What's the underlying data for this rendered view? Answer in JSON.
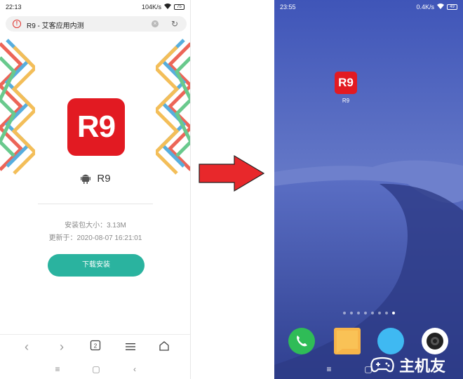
{
  "left_phone": {
    "status": {
      "time": "22:13",
      "speed": "104K/s",
      "battery": "75"
    },
    "url_bar": {
      "title": "R9 - 艾客应用内测"
    },
    "app": {
      "icon_text": "R9",
      "name": "R9"
    },
    "info": {
      "size": "安装包大小：3.13M",
      "updated": "更新于：2020-08-07 16:21:01"
    },
    "download_label": "下载安装"
  },
  "right_phone": {
    "status": {
      "time": "23:55",
      "speed": "0.4K/s",
      "battery": "49"
    },
    "home_app": {
      "icon_text": "R9",
      "label": "R9"
    },
    "page_dots": {
      "count": 8,
      "active_index": 7
    },
    "watermark_text": "主机友"
  },
  "colors": {
    "brand_red": "#e21a22",
    "download_green": "#2ab39f",
    "arrow_red": "#e8282b",
    "wallpaper_blue": "#4257b8"
  },
  "icons": [
    "warning-icon",
    "clear-icon",
    "reload-icon",
    "android-icon",
    "back-icon",
    "forward-icon",
    "scan-icon",
    "menu-icon",
    "home-icon",
    "phone-icon",
    "message-icon",
    "browser-icon",
    "camera-icon"
  ]
}
